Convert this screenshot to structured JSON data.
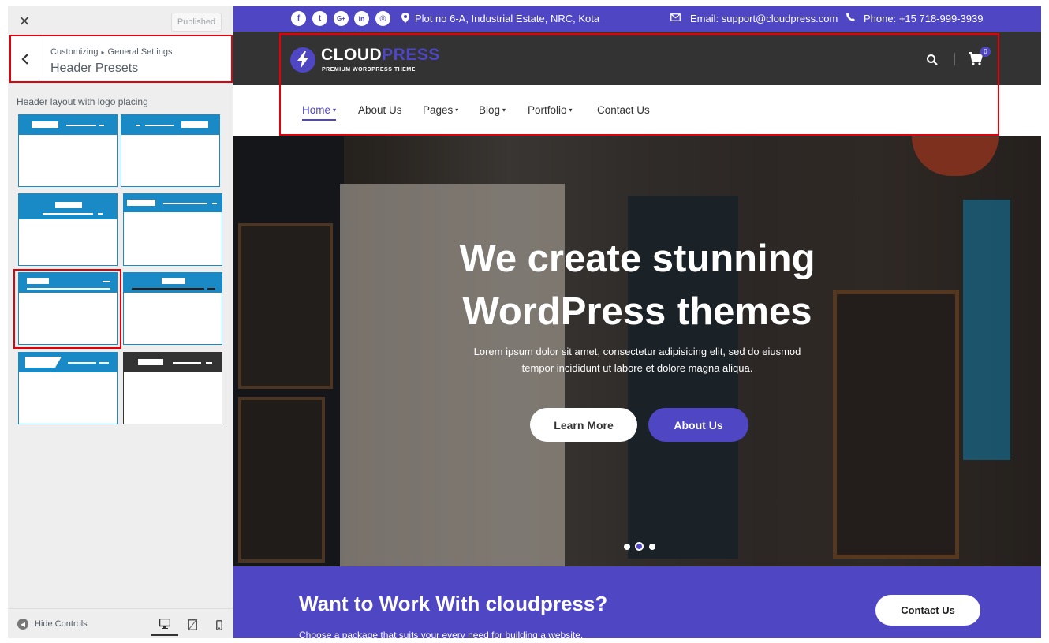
{
  "customizer": {
    "close_glyph": "✕",
    "publish_label": "Published",
    "back_glyph": "‹",
    "breadcrumb": {
      "root": "Customizing",
      "separator": "▸",
      "parent": "General Settings"
    },
    "section_title": "Header Presets",
    "layout_label": "Header layout with logo placing",
    "footer": {
      "hide_label": "Hide Controls"
    },
    "colors": {
      "preset_blue": "#1a8ac7",
      "preset_dark": "#333333",
      "highlight": "#e3000b"
    }
  },
  "site": {
    "topbar": {
      "social_icons": [
        "facebook-icon",
        "twitter-icon",
        "google-plus-icon",
        "linkedin-icon",
        "instagram-icon"
      ],
      "social_glyphs": [
        "f",
        "t",
        "G+",
        "in",
        "◎"
      ],
      "address": "Plot no 6-A, Industrial Estate, NRC, Kota",
      "email": "Email: support@cloudpress.com",
      "phone": "Phone: +15 718-999-3939"
    },
    "logo": {
      "part1": "CLOUD",
      "part2": "PRESS",
      "tagline": "PREMIUM WORDPRESS THEME"
    },
    "cart_count": "0",
    "nav": [
      "Home",
      "About Us",
      "Pages",
      "Blog",
      "Portfolio",
      "Contact Us"
    ],
    "nav_caret": "▾",
    "hero": {
      "title_line1": "We create stunning",
      "title_line2": "WordPress themes",
      "subtitle_line1": "Lorem ipsum dolor sit amet, consectetur adipisicing elit, sed do eiusmod",
      "subtitle_line2": "tempor incididunt ut labore et dolore magna aliqua.",
      "btn_primary": "Learn More",
      "btn_secondary": "About Us",
      "active_slide": 2,
      "slide_count": 3
    },
    "cta": {
      "title": "Want to Work With cloudpress?",
      "subtitle": "Choose a package that suits your every need for building a website.",
      "button": "Contact Us"
    },
    "colors": {
      "brand": "#4f46c3",
      "header_dark": "#333333"
    }
  }
}
